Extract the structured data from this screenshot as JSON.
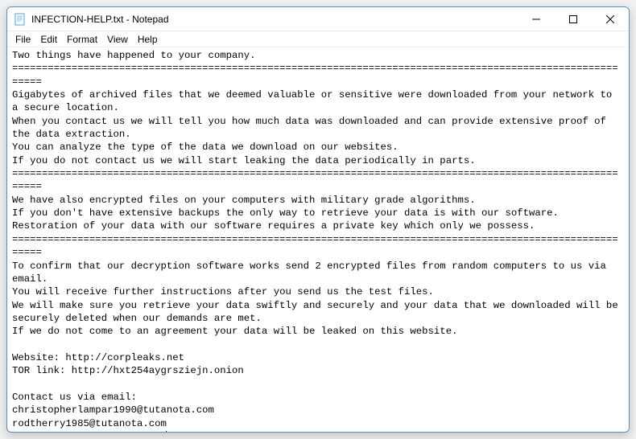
{
  "window": {
    "title": "INFECTION-HELP.txt - Notepad"
  },
  "menubar": {
    "file": "File",
    "edit": "Edit",
    "format": "Format",
    "view": "View",
    "help": "Help"
  },
  "document": {
    "text": "Two things have happened to your company.\n===========================================================================================================\nGigabytes of archived files that we deemed valuable or sensitive were downloaded from your network to a secure location.\nWhen you contact us we will tell you how much data was downloaded and can provide extensive proof of the data extraction.\nYou can analyze the type of the data we download on our websites.\nIf you do not contact us we will start leaking the data periodically in parts.\n===========================================================================================================\nWe have also encrypted files on your computers with military grade algorithms.\nIf you don't have extensive backups the only way to retrieve your data is with our software.\nRestoration of your data with our software requires a private key which only we possess.\n===========================================================================================================\nTo confirm that our decryption software works send 2 encrypted files from random computers to us via email.\nYou will receive further instructions after you send us the test files.\nWe will make sure you retrieve your data swiftly and securely and your data that we downloaded will be securely deleted when our demands are met.\nIf we do not come to an agreement your data will be leaked on this website.\n\nWebsite: http://corpleaks.net\nTOR link: http://hxt254aygrsziejn.onion\n\nContact us via email:\nchristopherlampar1990@tutanota.com\nrodtherry1985@tutanota.com\nlewisldupre@protonmail.com"
  }
}
